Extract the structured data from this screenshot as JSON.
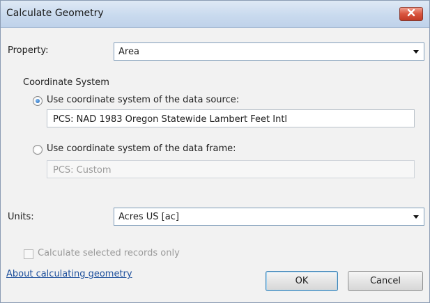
{
  "window": {
    "title": "Calculate Geometry",
    "close_icon": "close-icon"
  },
  "property": {
    "label": "Property:",
    "selected": "Area"
  },
  "coordinate_system": {
    "group_label": "Coordinate System",
    "data_source": {
      "label": "Use coordinate system of the data source:",
      "value": "PCS: NAD 1983 Oregon Statewide Lambert Feet Intl",
      "checked": true
    },
    "data_frame": {
      "label": "Use coordinate system of the data frame:",
      "value": "PCS: Custom",
      "checked": false
    }
  },
  "units": {
    "label": "Units:",
    "selected": "Acres US [ac]"
  },
  "selected_only": {
    "label": "Calculate selected records only",
    "checked": false
  },
  "help_link": "About calculating geometry",
  "buttons": {
    "ok": "OK",
    "cancel": "Cancel"
  },
  "colors": {
    "close_button": "#c9452f",
    "link": "#1d4f9c",
    "radio_selected": "#1a5fb4"
  }
}
